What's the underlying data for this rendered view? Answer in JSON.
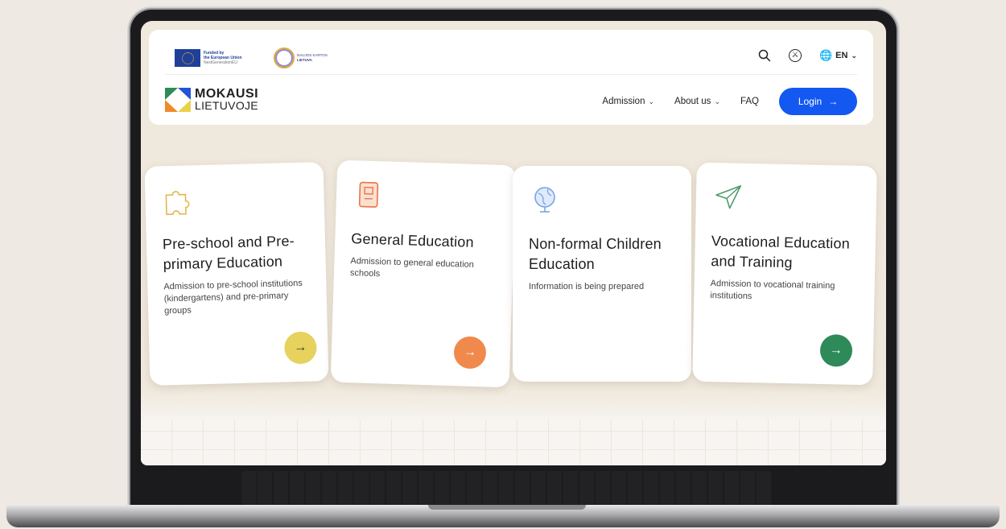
{
  "eu_logo": {
    "line1": "Funded by",
    "line2": "the European Union",
    "line3": "NextGenerationEU"
  },
  "partner_logo": {
    "line1": "NAUJOS KARTOS",
    "line2": "LIETUVA"
  },
  "top_bar": {
    "language": "EN"
  },
  "brand": {
    "line1": "MOKAUSI",
    "line2": "LIETUVOJE"
  },
  "nav": {
    "admission": "Admission",
    "about": "About us",
    "faq": "FAQ",
    "login": "Login"
  },
  "cards": [
    {
      "title": "Pre-school and Pre-primary Education",
      "desc": "Admission to pre-school institutions (kindergartens) and pre-primary groups",
      "icon": "puzzle-icon",
      "accent": "#e6d25c"
    },
    {
      "title": "General Education",
      "desc": "Admission to general education schools",
      "icon": "book-icon",
      "accent": "#ef8a4c"
    },
    {
      "title": "Non-formal Children Education",
      "desc": "Information is being prepared",
      "icon": "globe-icon",
      "accent": ""
    },
    {
      "title": "Vocational Education and Training",
      "desc": "Admission to vocational training institutions",
      "icon": "paper-plane-icon",
      "accent": "#2f8a5a"
    }
  ],
  "colors": {
    "primary": "#1458f2",
    "background": "#efe8dc"
  }
}
